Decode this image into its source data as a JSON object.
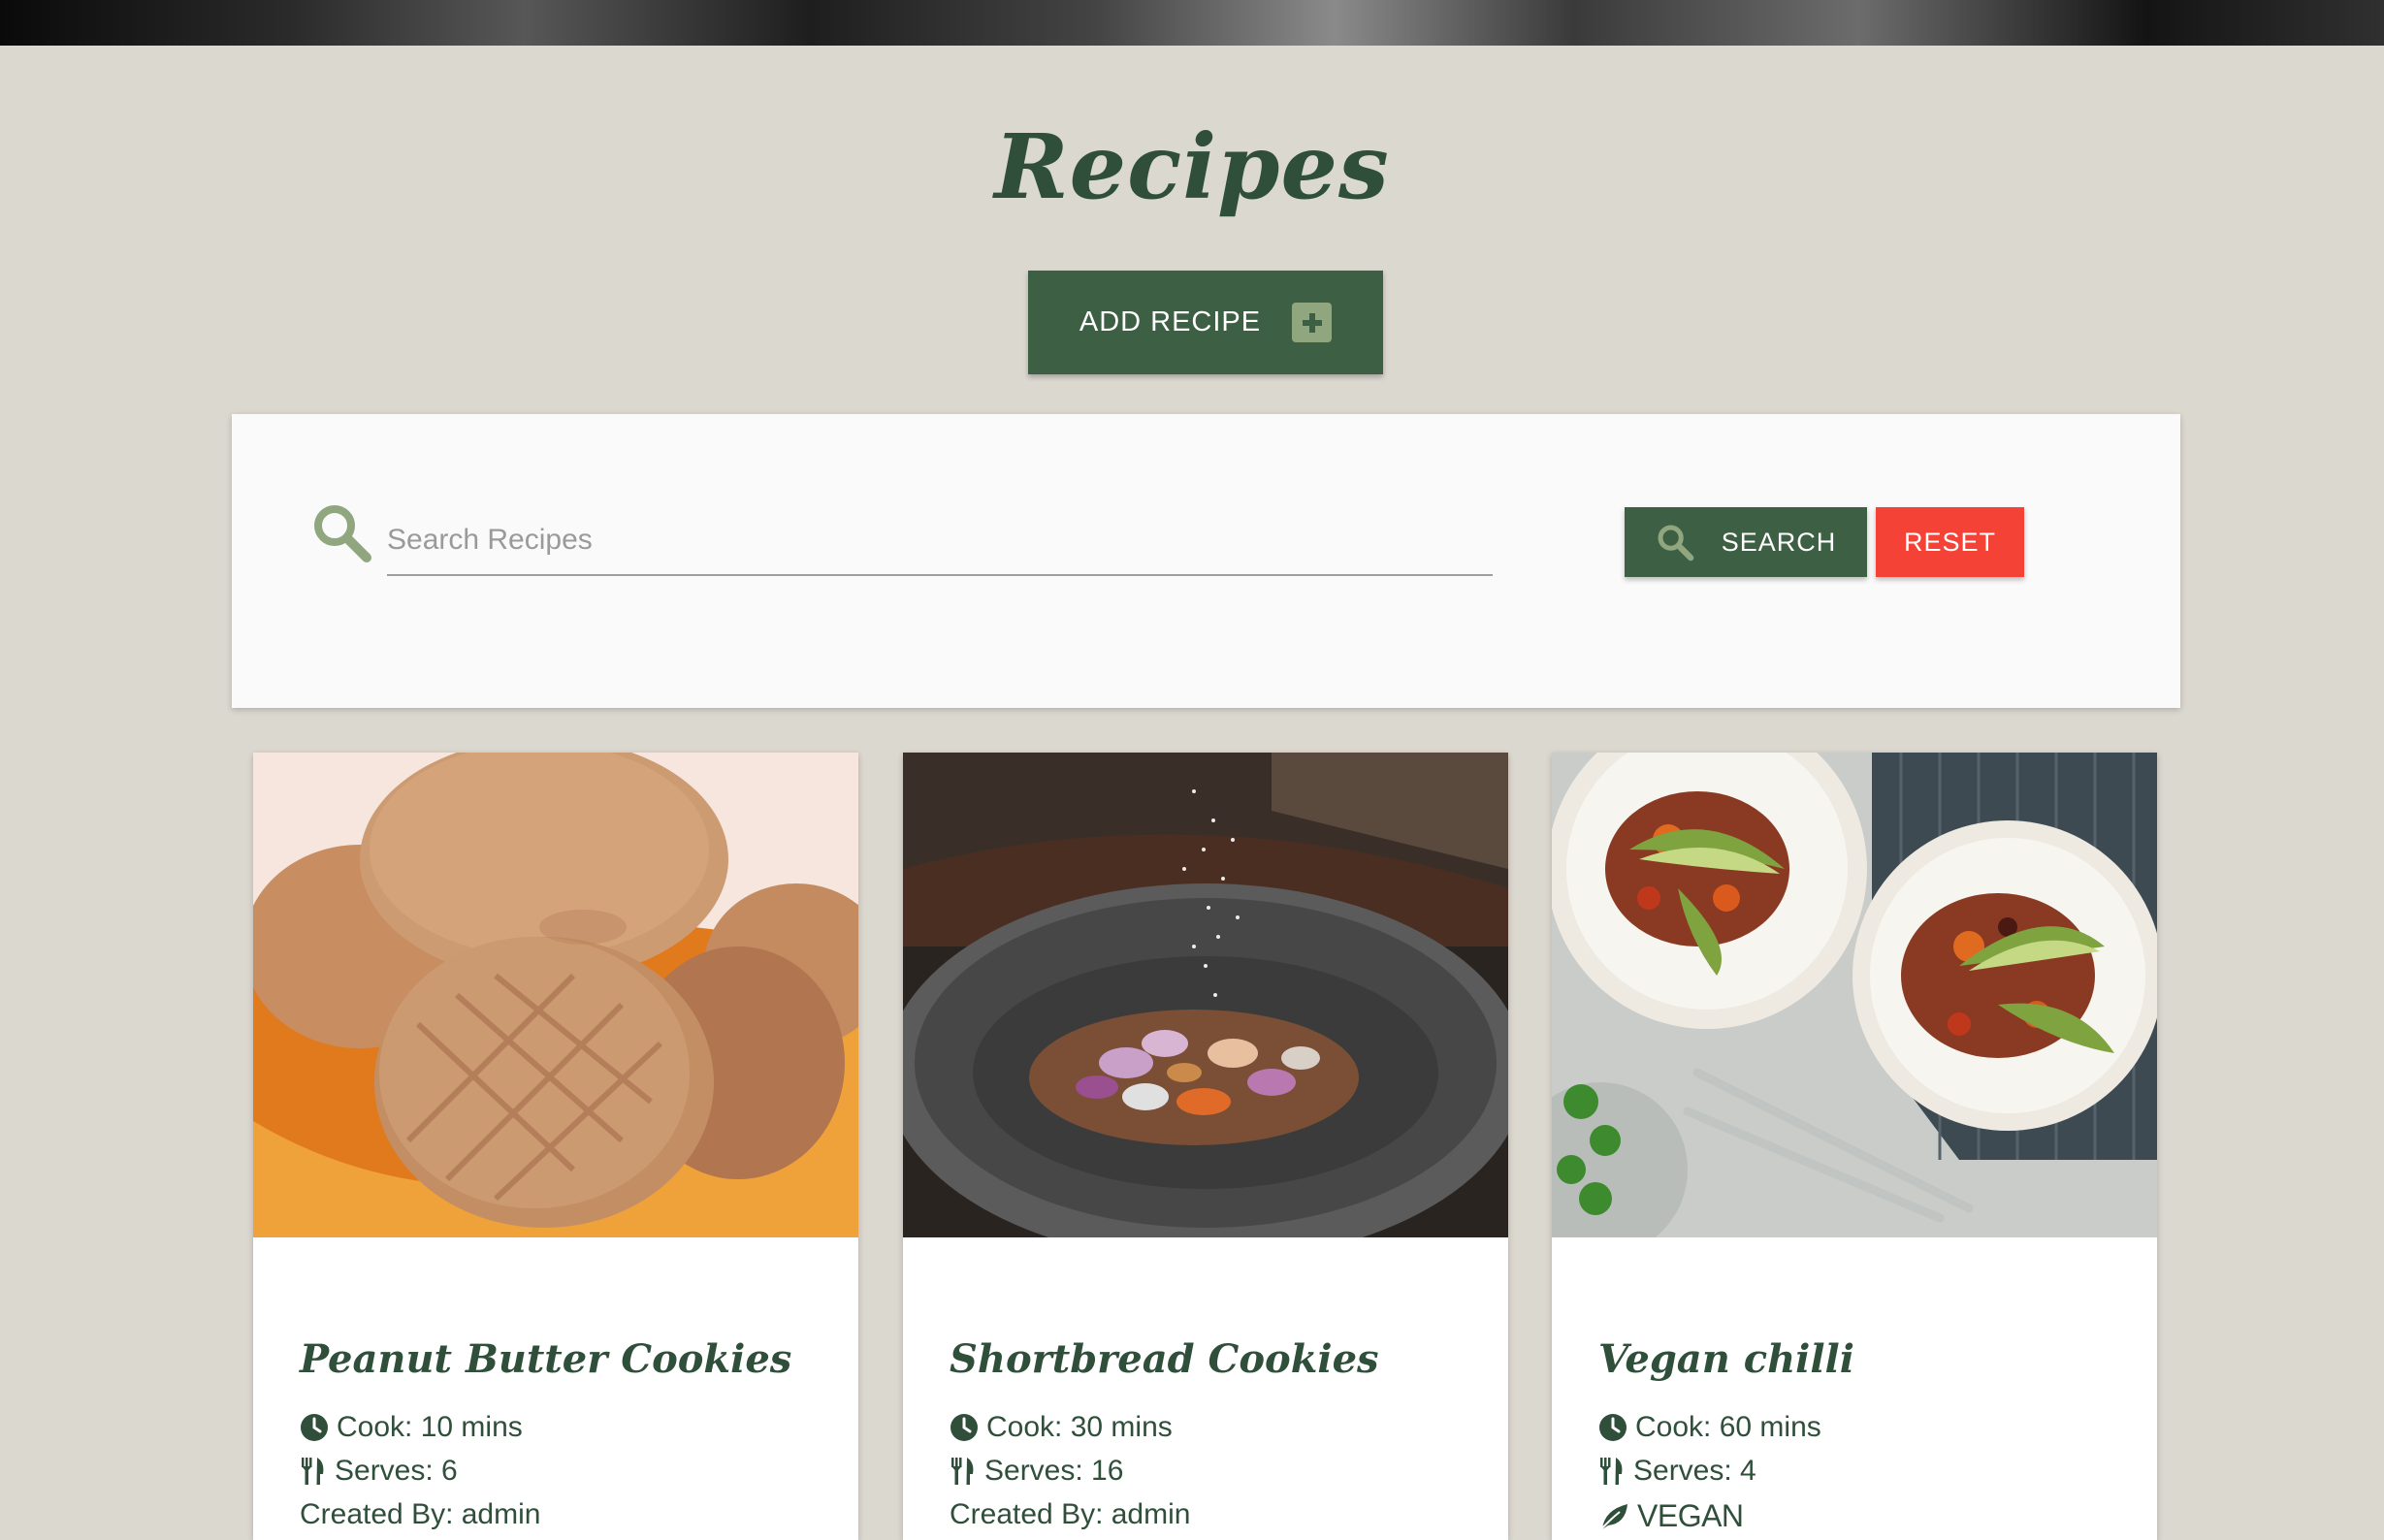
{
  "header": {
    "title": "Recipes",
    "add_recipe_label": "ADD RECIPE"
  },
  "search": {
    "placeholder": "Search Recipes",
    "value": "",
    "search_label": "SEARCH",
    "reset_label": "RESET"
  },
  "recipes": [
    {
      "title": "Peanut Butter Cookies",
      "cook": "Cook: 10 mins",
      "serves": "Serves: 6",
      "extra": "Created By: admin"
    },
    {
      "title": "Shortbread Cookies",
      "cook": "Cook: 30 mins",
      "serves": "Serves: 16",
      "extra": "Created By: admin"
    },
    {
      "title": "Vegan chilli",
      "cook": "Cook: 60 mins",
      "serves": "Serves: 4",
      "extra": "VEGAN"
    }
  ],
  "icons": {
    "search": "search-icon",
    "add": "plus-square-icon",
    "clock": "clock-icon",
    "serves": "utensils-icon",
    "vegan": "leaf-icon"
  },
  "colors": {
    "page_bg": "#dbd8d0",
    "brand_green": "#3d5f43",
    "heading_green": "#2f4f3b",
    "reset_red": "#f44336",
    "accent_sage": "#8fa67f"
  }
}
